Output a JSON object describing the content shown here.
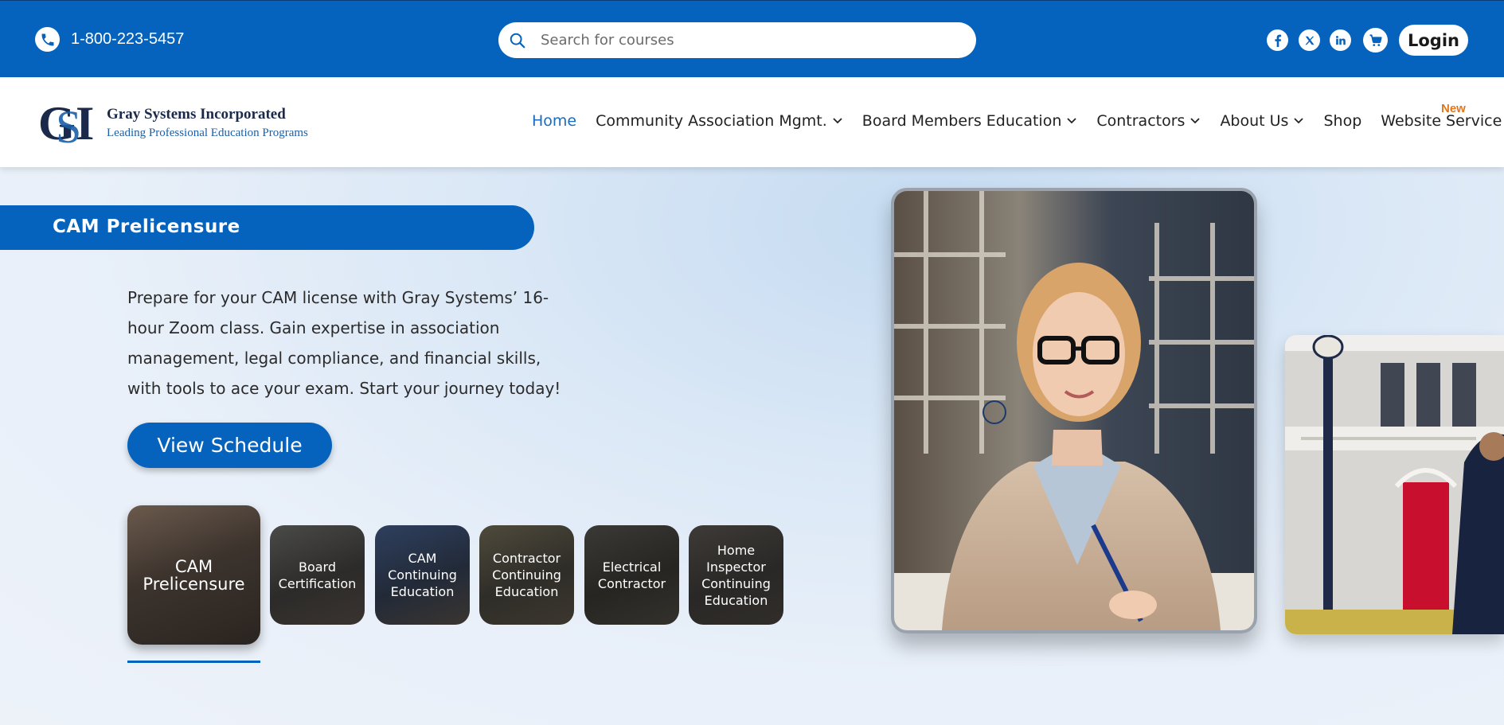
{
  "topbar": {
    "phone": "1-800-223-5457",
    "search_placeholder": "Search for courses",
    "social": [
      "facebook-icon",
      "x-icon",
      "linkedin-icon"
    ],
    "login_label": "Login"
  },
  "header": {
    "logo_name": "Gray Systems Incorporated",
    "logo_tagline": "Leading Professional Education Programs",
    "nav": [
      {
        "label": "Home",
        "active": true,
        "dropdown": false
      },
      {
        "label": "Community Association Mgmt.",
        "active": false,
        "dropdown": true
      },
      {
        "label": "Board Members Education",
        "active": false,
        "dropdown": true
      },
      {
        "label": "Contractors",
        "active": false,
        "dropdown": true
      },
      {
        "label": "About Us",
        "active": false,
        "dropdown": true
      },
      {
        "label": "Shop",
        "active": false,
        "dropdown": false
      },
      {
        "label": "Website Service",
        "active": false,
        "dropdown": false
      }
    ],
    "new_badge": "New"
  },
  "hero": {
    "title": "CAM Prelicensure",
    "description": "Prepare for your CAM license with Gray Systems’ 16-hour Zoom class. Gain expertise in association management, legal compliance, and financial skills, with tools to ace your exam. Start your journey today!",
    "cta_label": "View Schedule",
    "tiles": [
      {
        "label": "CAM Prelicensure",
        "active": true
      },
      {
        "label": "Board Certification",
        "active": false
      },
      {
        "label": "CAM Continuing Education",
        "active": false
      },
      {
        "label": "Contractor Continuing Education",
        "active": false
      },
      {
        "label": "Electrical Contractor",
        "active": false
      },
      {
        "label": "Home Inspector Continuing Education",
        "active": false
      }
    ]
  },
  "colors": {
    "brand_blue": "#0663bd",
    "new_badge": "#e0771e",
    "active_nav": "#1a6cc0"
  }
}
